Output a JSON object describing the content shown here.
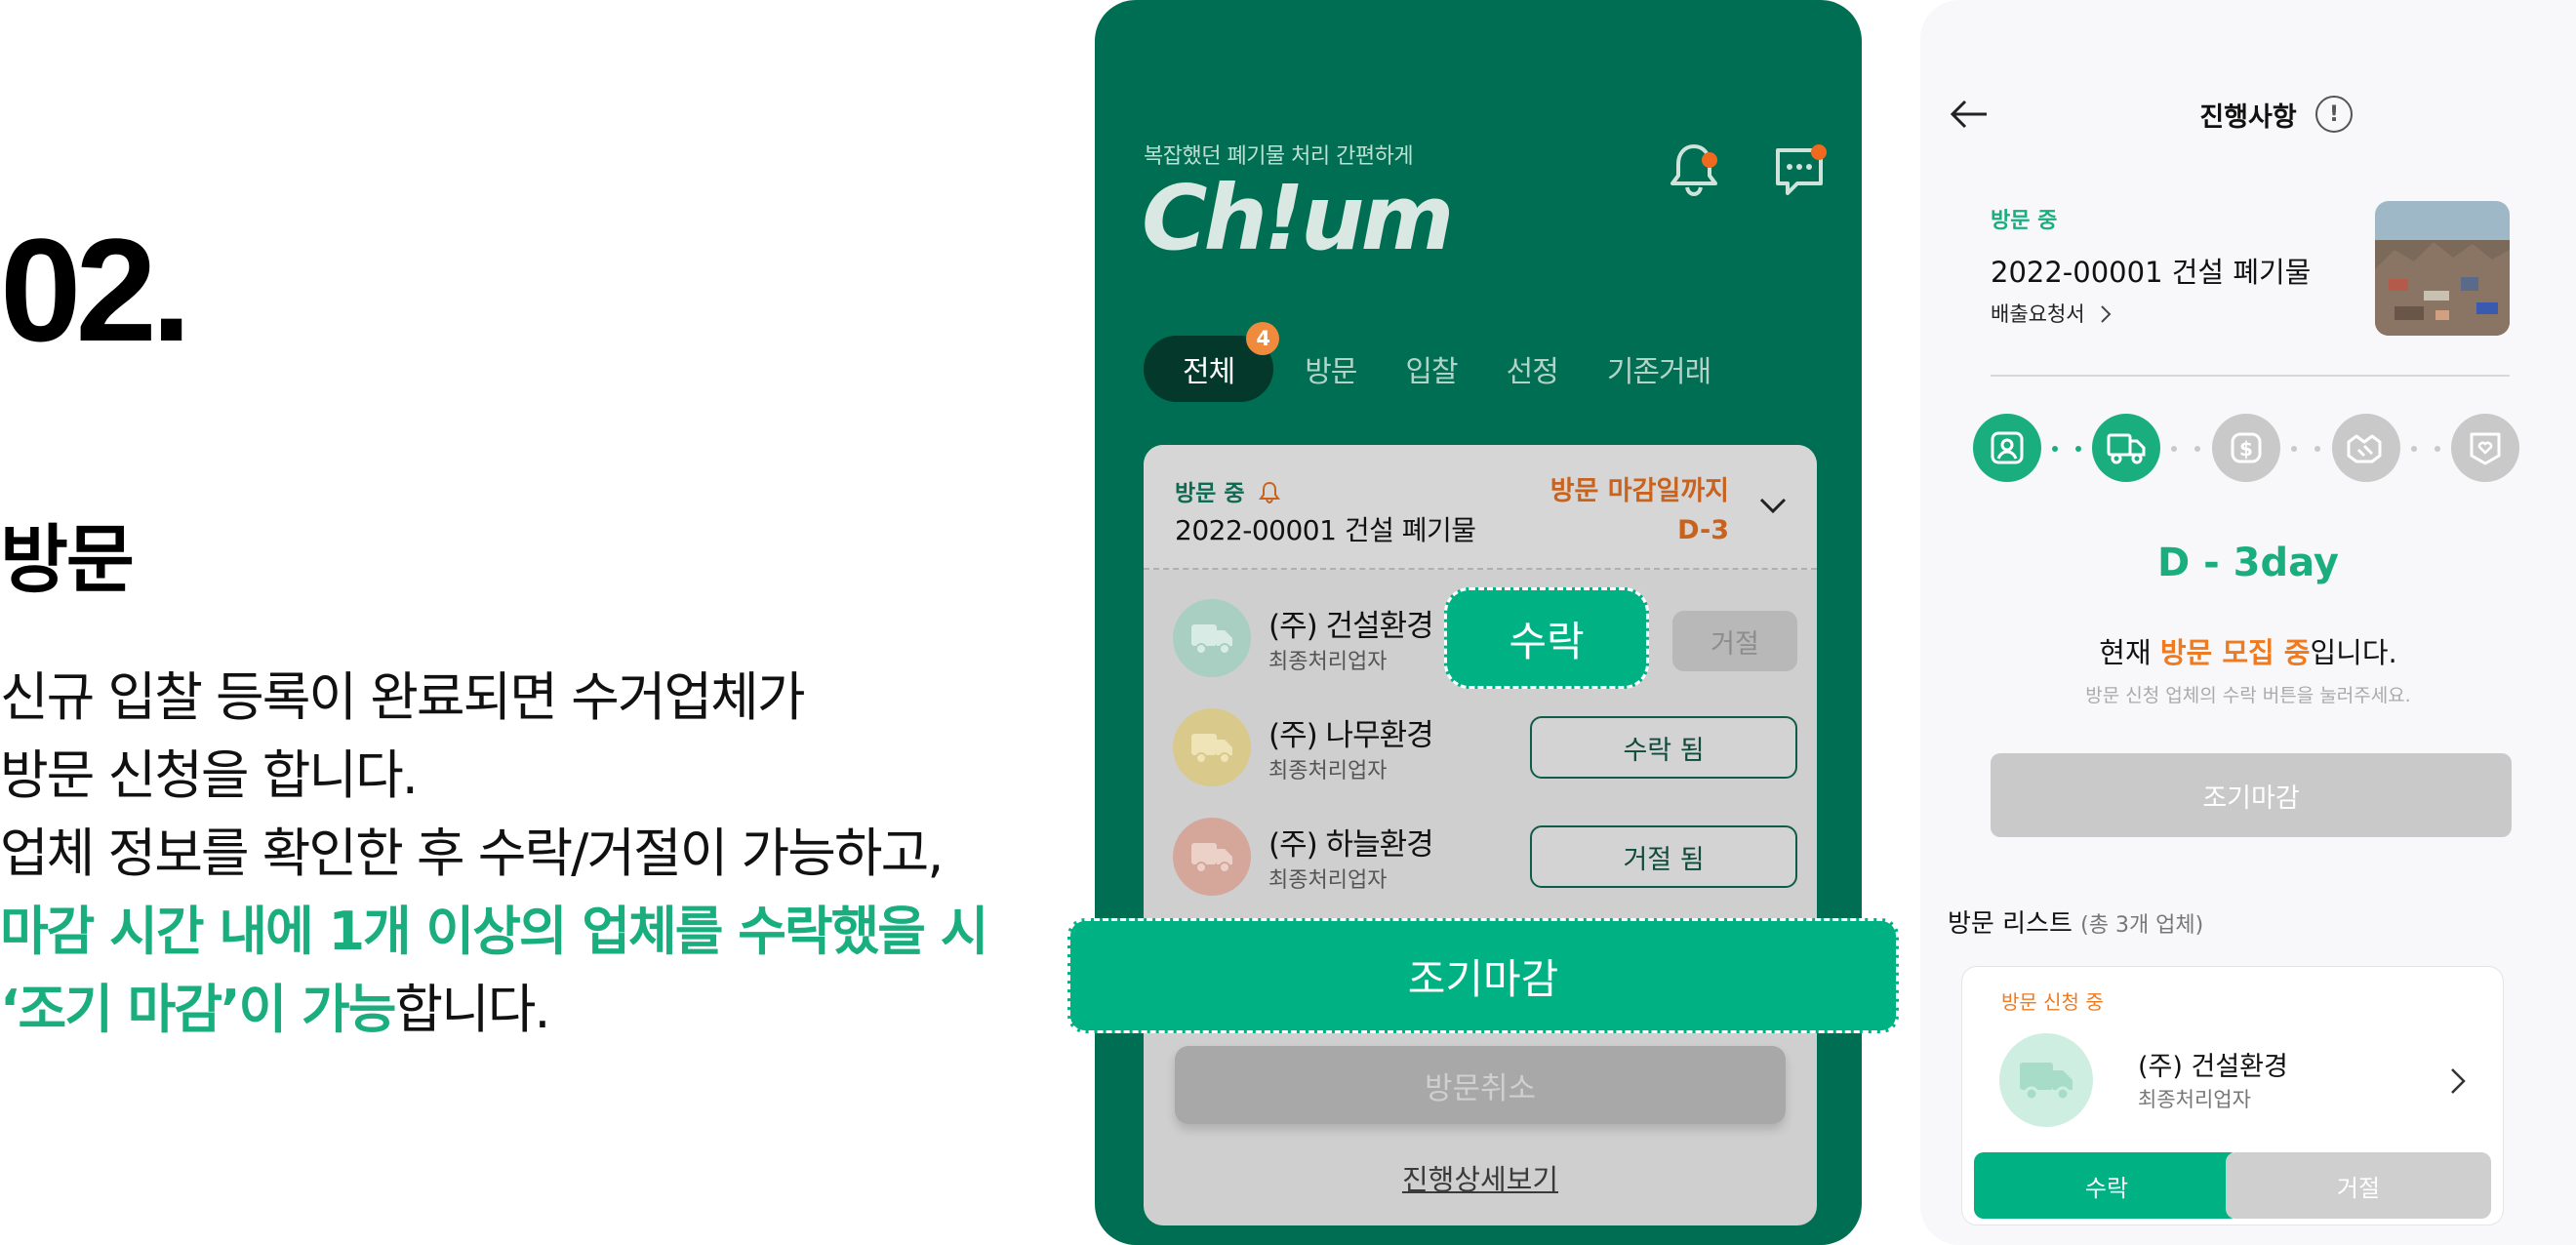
{
  "intro": {
    "number": "02.",
    "title": "방문",
    "lines": [
      "신규 입찰 등록이 완료되면 수거업체가",
      "방문 신청을 합니다.",
      "업체 정보를 확인한 후 수락/거절이 가능하고,"
    ],
    "highlight_1": "마감 시간 내에 1개 이상의 업체를 수락했을 시",
    "highlight_2": "‘조기 마감’이 가능",
    "suffix": "합니다."
  },
  "main_screen": {
    "tagline": "복잡했던 폐기물 처리 간편하게",
    "logo": "Ch!um",
    "tabs": [
      {
        "label": "전체",
        "badge": "4"
      },
      {
        "label": "방문"
      },
      {
        "label": "입찰"
      },
      {
        "label": "선정"
      },
      {
        "label": "기존거래"
      }
    ],
    "card": {
      "status": "방문 중",
      "title": "2022-00001 건설 폐기물",
      "deadline_label": "방문 마감일까지",
      "deadline_value": "D-3"
    },
    "vendors": [
      {
        "name": "(주) 건설환경",
        "type": "최종처리업자",
        "reject_label": "거절"
      },
      {
        "name": "(주) 나무환경",
        "type": "최종처리업자",
        "action_label": "수락 됨"
      },
      {
        "name": "(주) 하늘환경",
        "type": "최종처리업자",
        "action_label": "거절 됨"
      }
    ],
    "accept_label": "수락",
    "early_close_label": "조기마감",
    "cancel_label": "방문취소",
    "detail_link": "진행상세보기"
  },
  "detail_screen": {
    "title": "진행사항",
    "info_icon": "!",
    "status": "방문 중",
    "item_name": "2022-00001 건설 폐기물",
    "request_link": "배출요청서",
    "dday": "D - 3day",
    "now_prefix": "현재 ",
    "now_highlight": "방문 모집 중",
    "now_suffix": "입니다.",
    "hint": "방문 신청 업체의 수락 버튼을 눌러주세요.",
    "early_close_label": "조기마감",
    "list_title": "방문 리스트",
    "list_count": "(총 3개 업체)",
    "card": {
      "status": "방문 신청 중",
      "name": "(주) 건설환경",
      "type": "최종처리업자",
      "accept_label": "수락",
      "reject_label": "거절"
    }
  },
  "colors": {
    "brand_green": "#006e53",
    "accent_green": "#1aae7f",
    "accent_orange": "#ef7a1f"
  }
}
